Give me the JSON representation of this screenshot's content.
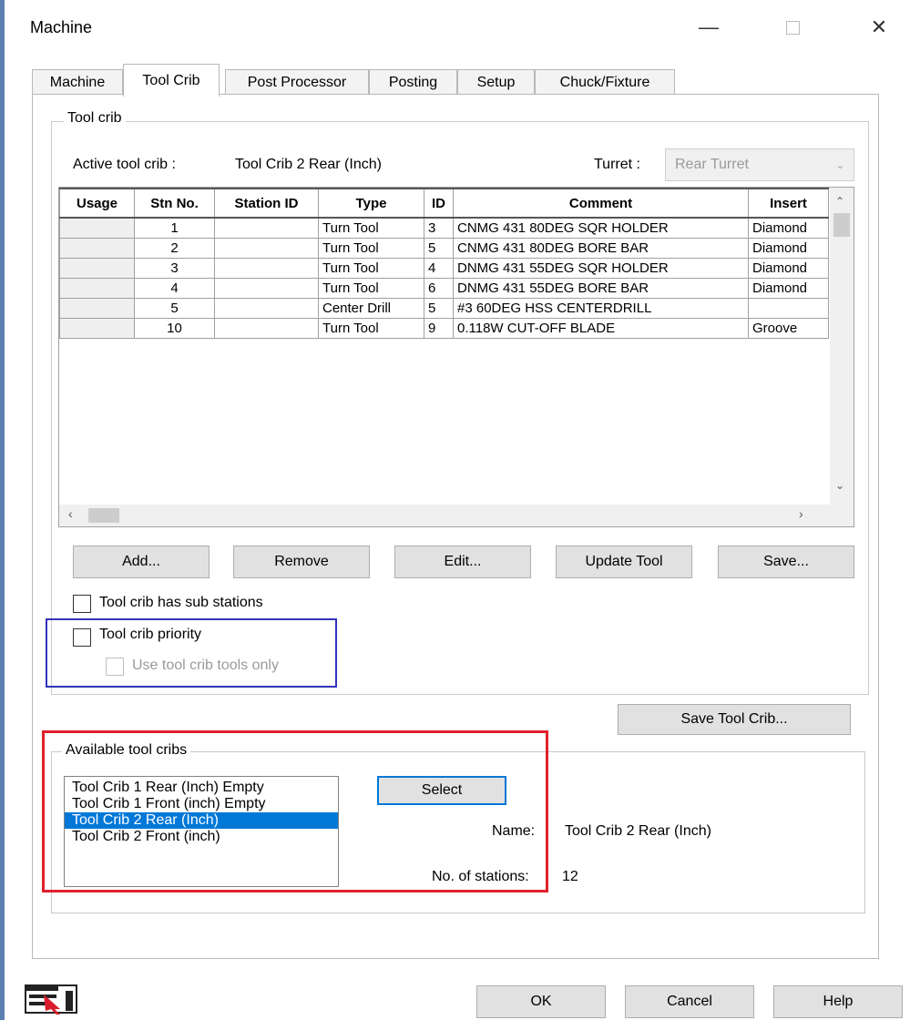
{
  "window": {
    "title": "Machine"
  },
  "tabs": [
    {
      "label": "Machine"
    },
    {
      "label": "Tool Crib"
    },
    {
      "label": "Post Processor"
    },
    {
      "label": "Posting"
    },
    {
      "label": "Setup"
    },
    {
      "label": "Chuck/Fixture"
    }
  ],
  "toolcrib": {
    "legend": "Tool crib",
    "active_label": "Active tool crib :",
    "active_value": "Tool Crib 2 Rear (Inch)",
    "turret_label": "Turret :",
    "turret_value": "Rear Turret",
    "columns": [
      "Usage",
      "Stn No.",
      "Station ID",
      "Type",
      "ID",
      "Comment",
      "Insert"
    ],
    "rows": [
      {
        "usage": "",
        "stn": "1",
        "station_id": "",
        "type": "Turn Tool",
        "id": "3",
        "comment": "CNMG 431 80DEG SQR HOLDER",
        "insert": "Diamond"
      },
      {
        "usage": "",
        "stn": "2",
        "station_id": "",
        "type": "Turn Tool",
        "id": "5",
        "comment": "CNMG 431 80DEG BORE BAR",
        "insert": "Diamond"
      },
      {
        "usage": "",
        "stn": "3",
        "station_id": "",
        "type": "Turn Tool",
        "id": "4",
        "comment": "DNMG 431 55DEG SQR HOLDER",
        "insert": "Diamond"
      },
      {
        "usage": "",
        "stn": "4",
        "station_id": "",
        "type": "Turn Tool",
        "id": "6",
        "comment": "DNMG 431 55DEG BORE BAR",
        "insert": "Diamond"
      },
      {
        "usage": "",
        "stn": "5",
        "station_id": "",
        "type": "Center Drill",
        "id": "5",
        "comment": "#3 60DEG HSS CENTERDRILL",
        "insert": ""
      },
      {
        "usage": "",
        "stn": "10",
        "station_id": "",
        "type": "Turn Tool",
        "id": "9",
        "comment": "0.118W CUT-OFF BLADE",
        "insert": "Groove"
      }
    ],
    "buttons": {
      "add": "Add...",
      "remove": "Remove",
      "edit": "Edit...",
      "update": "Update Tool",
      "save": "Save..."
    },
    "sub_stations": {
      "label": "Tool crib has sub stations",
      "checked": false
    },
    "priority": {
      "label": "Tool crib priority",
      "checked": false
    },
    "use_only": {
      "label": "Use tool crib tools only",
      "checked": false,
      "disabled": true
    },
    "save_crib": "Save Tool Crib..."
  },
  "available": {
    "legend": "Available tool cribs",
    "items": [
      {
        "label": "Tool Crib 1 Rear (Inch) Empty",
        "selected": false
      },
      {
        "label": "Tool Crib 1 Front (inch) Empty",
        "selected": false
      },
      {
        "label": "Tool Crib 2 Rear (Inch)",
        "selected": true
      },
      {
        "label": "Tool Crib 2 Front (inch)",
        "selected": false
      }
    ],
    "select_button": "Select",
    "name_label": "Name:",
    "name_value": "Tool Crib 2 Rear (Inch)",
    "stations_label": "No. of stations:",
    "stations_value": "12"
  },
  "footer": {
    "ok": "OK",
    "cancel": "Cancel",
    "help": "Help"
  },
  "colors": {
    "highlight_blue": "#3333bb",
    "highlight_red": "#e0202a",
    "selection": "#0078d7"
  }
}
